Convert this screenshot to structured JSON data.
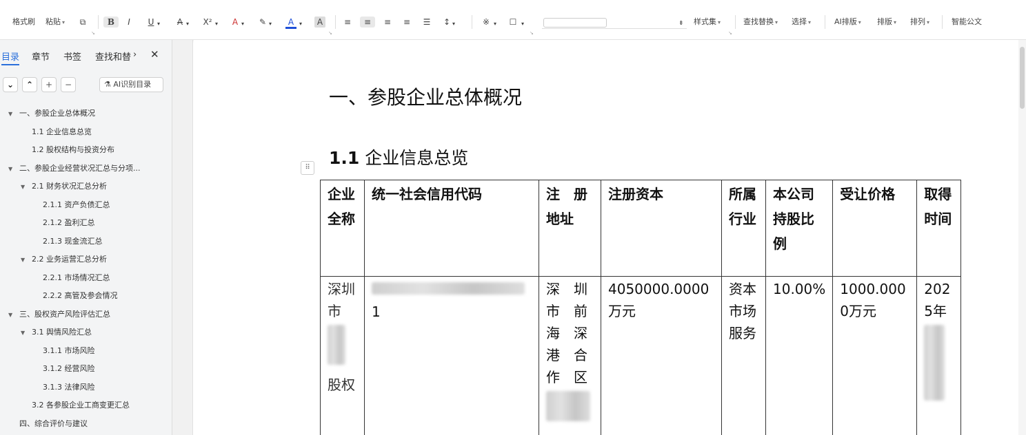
{
  "toolbar": {
    "items": [
      {
        "label": "格式刷",
        "icon": "",
        "dd": false
      },
      {
        "label": "粘贴",
        "icon": "",
        "dd": true
      },
      {
        "label": "",
        "icon": "copy-icon",
        "dd": false
      },
      {
        "label": "B",
        "icon": "bold-icon",
        "dd": false
      },
      {
        "label": "I",
        "icon": "italic-icon",
        "dd": false
      },
      {
        "label": "U",
        "icon": "underline-icon",
        "dd": true
      },
      {
        "label": "A",
        "icon": "strike-icon",
        "dd": true
      },
      {
        "label": "X²",
        "icon": "superscript-icon",
        "dd": true
      },
      {
        "label": "A",
        "icon": "text-effect-icon",
        "dd": true
      },
      {
        "label": "✎",
        "icon": "highlight-icon",
        "dd": true
      },
      {
        "label": "A",
        "icon": "font-color-icon",
        "dd": true
      },
      {
        "label": "A",
        "icon": "char-shading-icon",
        "dd": false
      }
    ],
    "style_set": "样式集",
    "find_replace": "查找替换",
    "select": "选择",
    "ai_layout": "AI排版",
    "layout": "排版",
    "arrange": "排列",
    "smart_doc": "智能公文"
  },
  "sidebar": {
    "tabs": [
      "目录",
      "章节",
      "书签",
      "查找和替"
    ],
    "ai_button": "AI识别目录",
    "outline": [
      {
        "label": "一、参股企业总体概况",
        "level": 0,
        "caret": true
      },
      {
        "label": "1.1 企业信息总览",
        "level": 1,
        "caret": false
      },
      {
        "label": "1.2 股权结构与投资分布",
        "level": 1,
        "caret": false
      },
      {
        "label": "二、参股企业经营状况汇总与分项...",
        "level": 0,
        "caret": true
      },
      {
        "label": "2.1 财务状况汇总分析",
        "level": 1,
        "caret": true
      },
      {
        "label": "2.1.1 资产负债汇总",
        "level": 2,
        "caret": false
      },
      {
        "label": "2.1.2 盈利汇总",
        "level": 2,
        "caret": false
      },
      {
        "label": "2.1.3 现金流汇总",
        "level": 2,
        "caret": false
      },
      {
        "label": "2.2 业务运营汇总分析",
        "level": 1,
        "caret": true
      },
      {
        "label": "2.2.1 市场情况汇总",
        "level": 2,
        "caret": false
      },
      {
        "label": "2.2.2 高管及参会情况",
        "level": 2,
        "caret": false
      },
      {
        "label": "三、股权资产风险评估汇总",
        "level": 0,
        "caret": true
      },
      {
        "label": "3.1 舆情风险汇总",
        "level": 1,
        "caret": true
      },
      {
        "label": "3.1.1 市场风险",
        "level": 2,
        "caret": false
      },
      {
        "label": "3.1.2 经营风险",
        "level": 2,
        "caret": false
      },
      {
        "label": "3.1.3 法律风险",
        "level": 2,
        "caret": false
      },
      {
        "label": "3.2 各参股企业工商变更汇总",
        "level": 1,
        "caret": false
      },
      {
        "label": "四、综合评价与建议",
        "level": 0,
        "caret": false
      }
    ]
  },
  "document": {
    "heading1": "一、参股企业总体概况",
    "heading2_num": "1.1",
    "heading2_text": " 企业信息总览",
    "table": {
      "headers": [
        "企业全称",
        "统一社会信用代码",
        "注　册地址",
        "注册资本",
        "所属行业",
        "本公司持股比例",
        "受让价格",
        "取得时间"
      ],
      "row1": {
        "name_top": "深圳市",
        "name_bottom": "股权",
        "code_tail": "1",
        "address": "深　圳市　前海　深港　合作　区",
        "capital": "4050000.0000万元",
        "industry": "资本市场服务",
        "ratio": "10.00%",
        "price": "1000.0000万元",
        "time": "2025年"
      }
    }
  }
}
